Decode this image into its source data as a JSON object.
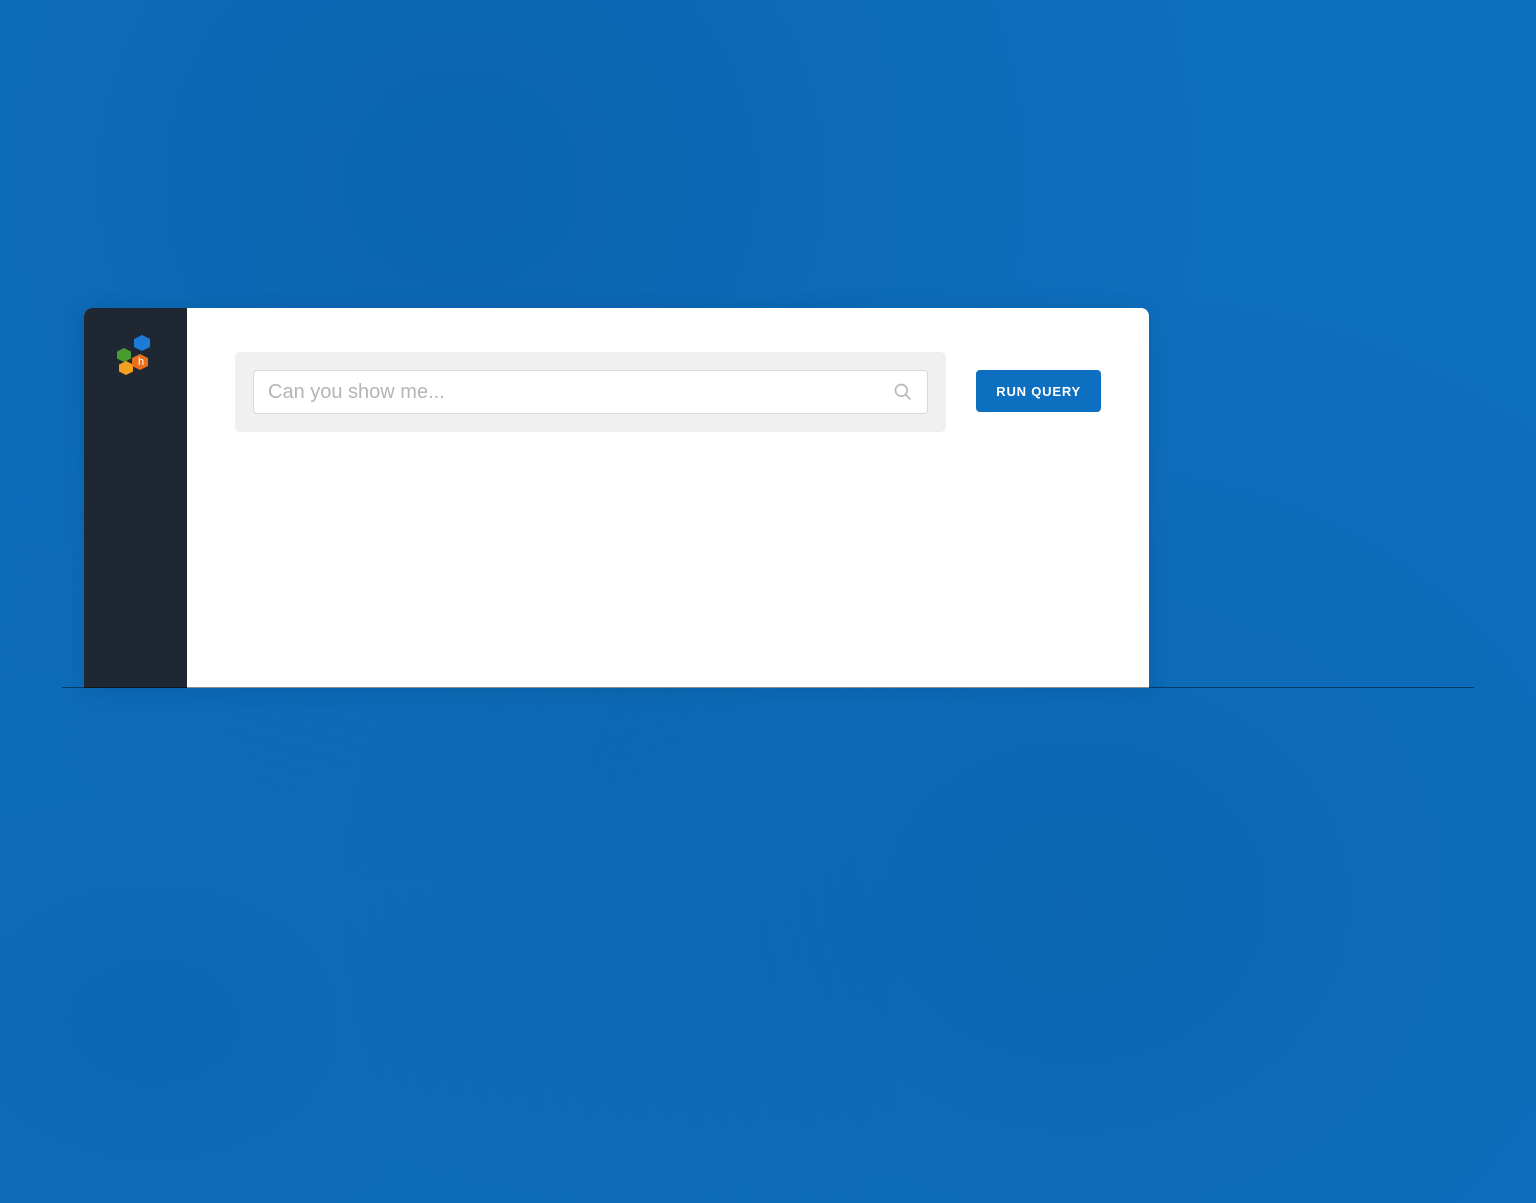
{
  "logo": {
    "letter": "h"
  },
  "search": {
    "placeholder": "Can you show me...",
    "value": ""
  },
  "actions": {
    "run_query_label": "RUN QUERY"
  },
  "colors": {
    "background": "#0d6fbf",
    "sidebar": "#1f2733",
    "button_primary": "#0d6fbf",
    "logo_blue": "#1c7bd6",
    "logo_green": "#4a9b2f",
    "logo_orange1": "#e86f1c",
    "logo_orange2": "#f3a01f"
  }
}
